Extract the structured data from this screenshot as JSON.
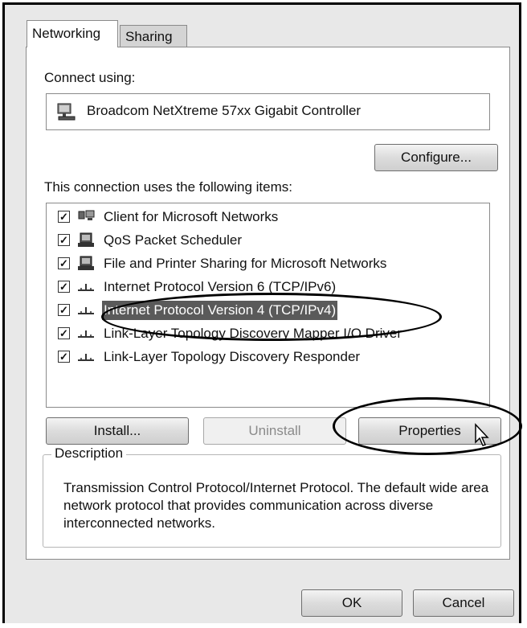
{
  "tabs": [
    {
      "label": "Networking",
      "active": true
    },
    {
      "label": "Sharing",
      "active": false
    }
  ],
  "connect_using_label": "Connect using:",
  "adapter": {
    "icon": "network-adapter-icon",
    "name": "Broadcom NetXtreme 57xx Gigabit Controller"
  },
  "configure_label": "Configure...",
  "items_label": "This connection uses the following items:",
  "items": [
    {
      "label": "Client for Microsoft Networks",
      "checked": true,
      "icon": "network-client-icon"
    },
    {
      "label": "QoS Packet Scheduler",
      "checked": true,
      "icon": "service-icon"
    },
    {
      "label": "File and Printer Sharing for Microsoft Networks",
      "checked": true,
      "icon": "service-icon"
    },
    {
      "label": "Internet Protocol Version 6 (TCP/IPv6)",
      "checked": true,
      "icon": "protocol-icon"
    },
    {
      "label": "Internet Protocol Version 4 (TCP/IPv4)",
      "checked": true,
      "icon": "protocol-icon",
      "selected": true
    },
    {
      "label": "Link-Layer Topology Discovery Mapper I/O Driver",
      "checked": true,
      "icon": "protocol-icon"
    },
    {
      "label": "Link-Layer Topology Discovery Responder",
      "checked": true,
      "icon": "protocol-icon"
    }
  ],
  "buttons": {
    "install": "Install...",
    "uninstall": "Uninstall",
    "properties": "Properties"
  },
  "description": {
    "legend": "Description",
    "text": "Transmission Control Protocol/Internet Protocol. The default wide area network protocol that provides communication across diverse interconnected networks."
  },
  "footer": {
    "ok": "OK",
    "cancel": "Cancel"
  }
}
